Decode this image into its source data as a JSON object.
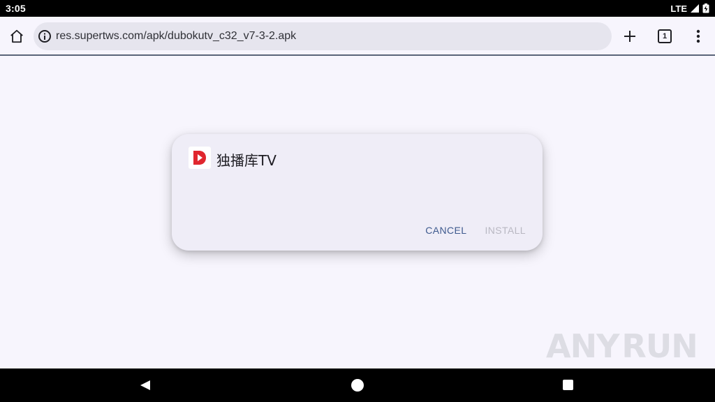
{
  "status_bar": {
    "time": "3:05",
    "network": "LTE",
    "signal_icon": "signal-icon",
    "battery_icon": "battery-icon"
  },
  "browser": {
    "url": "res.supertws.com/apk/dubokutv_c32_v7-3-2.apk",
    "tab_count": "1",
    "icons": {
      "home": "home-icon",
      "info": "info-icon",
      "new_tab": "plus-icon",
      "tabs": "tab-switcher-icon",
      "menu": "more-vert-icon"
    }
  },
  "install_dialog": {
    "app_name": "独播库TV",
    "app_icon": "dubokutv-app-icon",
    "cancel_label": "CANCEL",
    "install_label": "INSTALL",
    "install_enabled": false,
    "colors": {
      "background": "#efedf7",
      "cancel_text": "#3e5a8e",
      "install_text_disabled": "#b9b8c2",
      "app_icon_accent": "#e0262e"
    }
  },
  "watermark": {
    "text_left": "ANY",
    "text_right": "RUN"
  },
  "nav_bar": {
    "back_icon": "back-icon",
    "home_icon": "home-circle-icon",
    "recents_icon": "recents-icon"
  }
}
